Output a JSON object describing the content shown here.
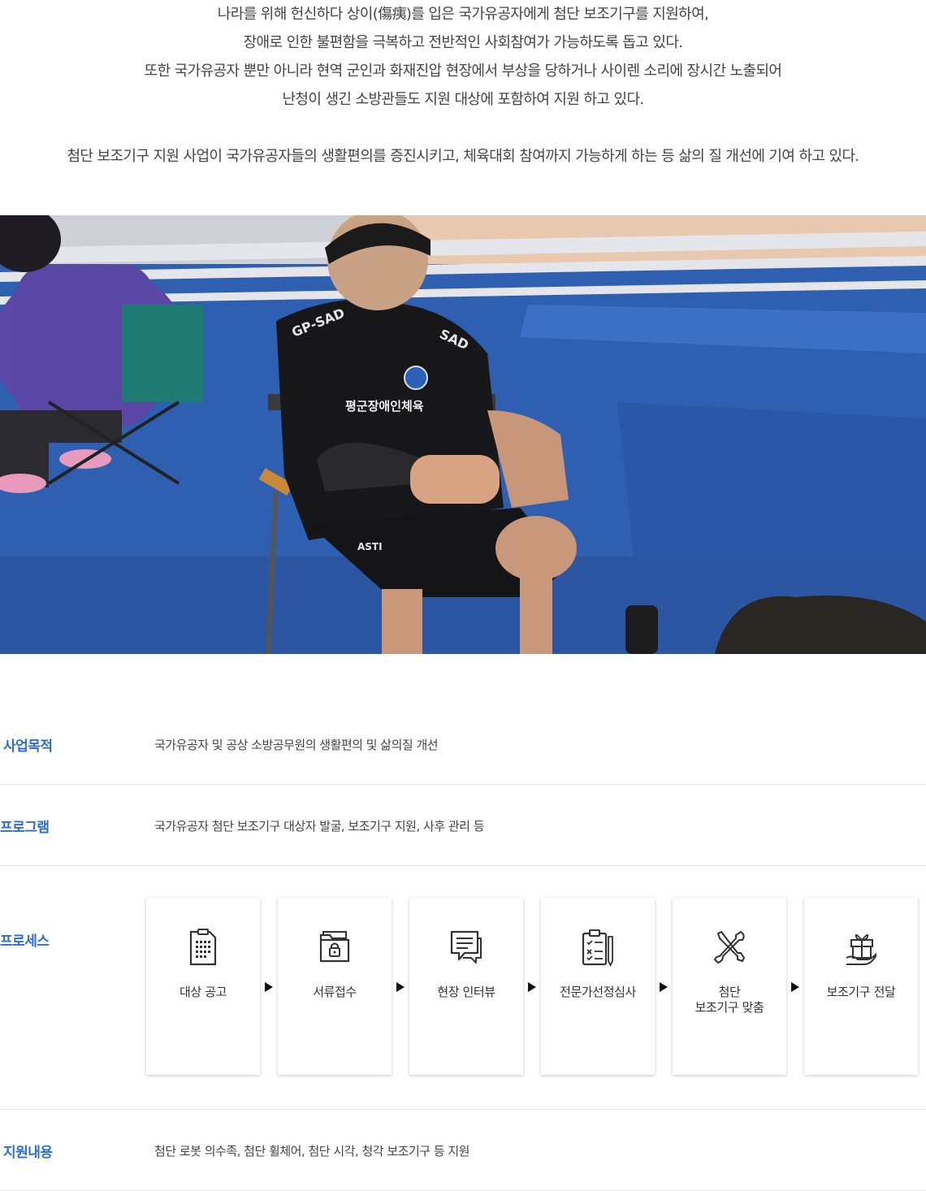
{
  "intro": {
    "lines": [
      "나라를 위해 헌신하다 상이(傷痍)를 입은 국가유공자에게 첨단 보조기구를 지원하여,",
      "장애로 인한 불편함을 극복하고 전반적인 사회참여가 가능하도록 돕고 있다.",
      "또한 국가유공자 뿐만 아니라 현역 군인과 화재진압 현장에서 부상을 당하거나 사이렌 소리에 장시간 노출되어",
      "난청이 생긴 소방관들도 지원 대상에 포함하여 지원 하고 있다."
    ],
    "summary": "첨단 보조기구 지원 사업이 국가유공자들의 생활편의를 증진시키고, 체육대회 참여까지 가능하게 하는 등 삶의 질 개선에 기여 하고 있다."
  },
  "photo": {
    "jersey_text": "GP-SAD",
    "jersey_text_right": "SAD",
    "chest_text": "평군장애인체육",
    "shorts_text": "ASTI"
  },
  "info": {
    "purpose": {
      "label": "사업목적",
      "value": "국가유공자 및 공상 소방공무원의 생활편의 및 삶의질 개선"
    },
    "program": {
      "label": "프로그램",
      "value": "국가유공자 첨단 보조기구 대상자 발굴, 보조기구 지원, 사후 관리 등"
    },
    "process": {
      "label": "프로세스",
      "steps": [
        {
          "label": "대상 공고",
          "icon": "notice-document-icon"
        },
        {
          "label": "서류접수",
          "icon": "folder-lock-icon"
        },
        {
          "label": "현장 인터뷰",
          "icon": "chat-bubble-icon"
        },
        {
          "label": "전문가선정심사",
          "icon": "clipboard-checklist-icon"
        },
        {
          "label": "첨단\n보조기구 맞춤",
          "icon": "tools-icon"
        },
        {
          "label": "보조기구 전달",
          "icon": "gift-hand-icon"
        }
      ]
    },
    "support": {
      "label": "지원내용",
      "value": "첨단 로봇 의수족, 첨단 휠체어, 첨단 시각, 청각 보조기구 등 지원"
    }
  },
  "colors": {
    "label_blue": "#2f6ecf",
    "divider": "#e3e3e3",
    "floor_blue": "#2f5fb0"
  }
}
